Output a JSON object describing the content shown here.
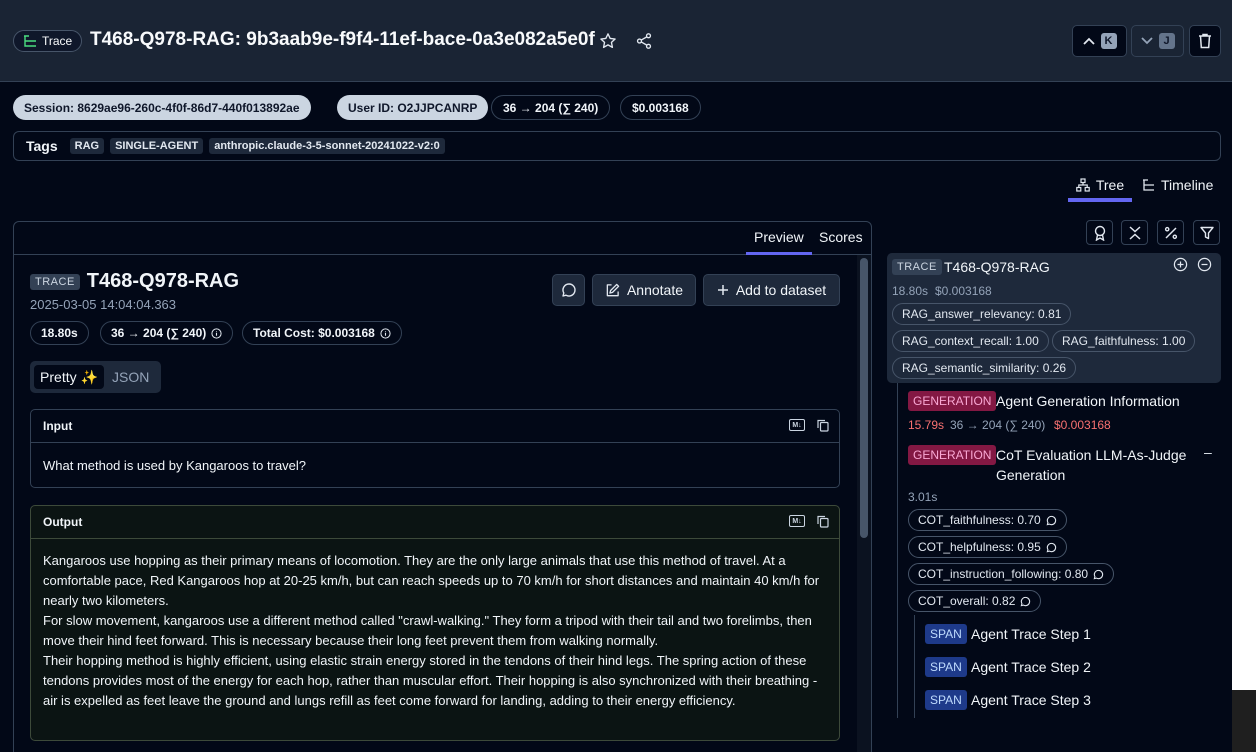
{
  "header": {
    "trace_pill_label": "Trace",
    "title": "T468-Q978-RAG: 9b3aab9e-f9f4-11ef-bace-0a3e082a5e0f",
    "prev_key": "K",
    "next_key": "J"
  },
  "meta": {
    "session": "Session: 8629ae96-260c-4f0f-86d7-440f013892ae",
    "user": "User ID: O2JJPCANRP",
    "tokens": "36 → 204 (∑ 240)",
    "cost": "$0.003168"
  },
  "tags": {
    "label": "Tags",
    "items": [
      "RAG",
      "SINGLE-AGENT",
      "anthropic.claude-3-5-sonnet-20241022-v2:0"
    ]
  },
  "view_tabs": {
    "tree": "Tree",
    "timeline": "Timeline"
  },
  "detail": {
    "tabs": {
      "preview": "Preview",
      "scores": "Scores"
    },
    "badge": "TRACE",
    "title": "T468-Q978-RAG",
    "timestamp": "2025-03-05 14:04:04.363",
    "latency": "18.80s",
    "tokens": "36 → 204 (∑ 240)",
    "total_cost": "Total Cost: $0.003168",
    "annotate_label": "Annotate",
    "dataset_label": "Add to dataset",
    "format_pretty": "Pretty ✨",
    "format_json": "JSON",
    "input_label": "Input",
    "input_text": "What method is used by Kangaroos to travel?",
    "output_label": "Output",
    "output_paragraphs": [
      "Kangaroos use hopping as their primary means of locomotion. They are the only large animals that use this method of travel. At a comfortable pace, Red Kangaroos hop at 20-25 km/h, but can reach speeds up to 70 km/h for short distances and maintain 40 km/h for nearly two kilometers.",
      "For slow movement, kangaroos use a different method called \"crawl-walking.\" They form a tripod with their tail and two forelimbs, then move their hind feet forward. This is necessary because their long feet prevent them from walking normally.",
      "Their hopping method is highly efficient, using elastic strain energy stored in the tendons of their hind legs. The spring action of these tendons provides most of the energy for each hop, rather than muscular effort. Their hopping is also synchronized with their breathing - air is expelled as feet leave the ground and lungs refill as feet come forward for landing, adding to their energy efficiency."
    ]
  },
  "tree": {
    "root": {
      "badge": "TRACE",
      "title": "T468-Q978-RAG",
      "latency": "18.80s",
      "cost": "$0.003168",
      "scores": [
        "RAG_answer_relevancy: 0.81",
        "RAG_context_recall: 1.00",
        "RAG_faithfulness: 1.00",
        "RAG_semantic_similarity: 0.26"
      ]
    },
    "gen1": {
      "badge": "GENERATION",
      "title": "Agent Generation Information",
      "latency": "15.79s",
      "tokens": "36 → 204 (∑ 240)",
      "cost": "$0.003168"
    },
    "gen2": {
      "badge": "GENERATION",
      "title_line1": "CoT Evaluation LLM-As-Judge",
      "title_line2": "Generation",
      "collapse": "–",
      "latency": "3.01s",
      "scores": [
        "COT_faithfulness: 0.70",
        "COT_helpfulness: 0.95",
        "COT_instruction_following: 0.80",
        "COT_overall: 0.82"
      ]
    },
    "spans": [
      {
        "badge": "SPAN",
        "title": "Agent Trace Step 1"
      },
      {
        "badge": "SPAN",
        "title": "Agent Trace Step 2"
      },
      {
        "badge": "SPAN",
        "title": "Agent Trace Step 3"
      }
    ]
  },
  "colors": {
    "accent": "#6366f1",
    "generation_bg": "#831843",
    "span_bg": "#1e3a8a",
    "latency_warn": "#f87171"
  }
}
